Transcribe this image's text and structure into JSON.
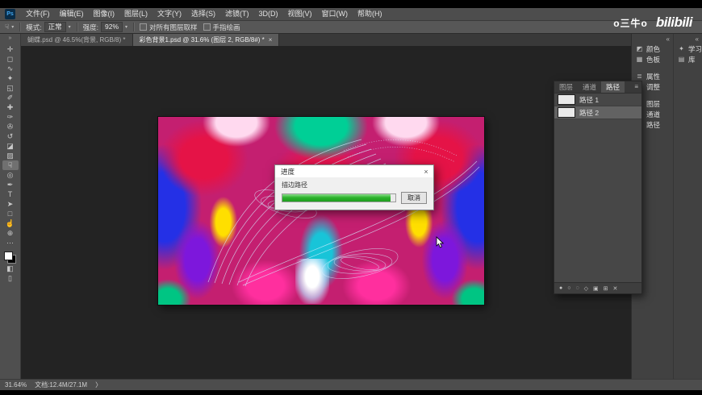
{
  "watermark": {
    "user": "o三牛o",
    "logo": "bilibili"
  },
  "icons": {
    "dropdown_caret": "▾"
  },
  "menubar": {
    "app_icon": "Ps",
    "items": [
      "文件(F)",
      "编辑(E)",
      "图像(I)",
      "图层(L)",
      "文字(Y)",
      "选择(S)",
      "滤镜(T)",
      "3D(D)",
      "视图(V)",
      "窗口(W)",
      "帮助(H)"
    ]
  },
  "options_bar": {
    "tool_icon": "☟",
    "mode_label": "模式:",
    "mode_value": "正常",
    "strength_label": "强度:",
    "strength_value": "92%",
    "sample_all_layers_label": "对所有图层取样",
    "finger_painting_label": "手指绘画"
  },
  "document_tabs": [
    {
      "label": "蝴蝶.psd @ 46.5%(背景, RGB/8) *",
      "active": false
    },
    {
      "label": "彩色背景1.psd @ 31.6% (图层 2, RGB/8#) *",
      "active": true,
      "close": "×"
    }
  ],
  "toolbar": {
    "collapse_icon": "»",
    "tools": [
      {
        "name": "move-tool",
        "glyph": "✛",
        "active": false
      },
      {
        "name": "marquee-tool",
        "glyph": "◻",
        "active": false
      },
      {
        "name": "lasso-tool",
        "glyph": "∿",
        "active": false
      },
      {
        "name": "quick-selection-tool",
        "glyph": "✦",
        "active": false
      },
      {
        "name": "crop-tool",
        "glyph": "◱",
        "active": false
      },
      {
        "name": "eyedropper-tool",
        "glyph": "✐",
        "active": false
      },
      {
        "name": "healing-brush-tool",
        "glyph": "✚",
        "active": false
      },
      {
        "name": "brush-tool",
        "glyph": "✑",
        "active": false
      },
      {
        "name": "clone-stamp-tool",
        "glyph": "✇",
        "active": false
      },
      {
        "name": "history-brush-tool",
        "glyph": "↺",
        "active": false
      },
      {
        "name": "eraser-tool",
        "glyph": "◪",
        "active": false
      },
      {
        "name": "gradient-tool",
        "glyph": "▨",
        "active": false
      },
      {
        "name": "smudge-tool",
        "glyph": "☟",
        "active": true
      },
      {
        "name": "dodge-tool",
        "glyph": "◎",
        "active": false
      },
      {
        "name": "pen-tool",
        "glyph": "✒",
        "active": false
      },
      {
        "name": "type-tool",
        "glyph": "T",
        "active": false
      },
      {
        "name": "path-selection-tool",
        "glyph": "➤",
        "active": false
      },
      {
        "name": "shape-tool",
        "glyph": "□",
        "active": false
      },
      {
        "name": "hand-tool",
        "glyph": "☝",
        "active": false
      },
      {
        "name": "zoom-tool",
        "glyph": "⊕",
        "active": false
      }
    ],
    "more_icon": "⋯",
    "quick_mask_icon": "◧",
    "screen_mode_icon": "▯"
  },
  "right_dock": {
    "collapse_icon": "«",
    "groups": [
      {
        "items": [
          {
            "name": "panel-button-color",
            "icon": "◩",
            "label": "颜色"
          },
          {
            "name": "panel-button-swatches",
            "icon": "▦",
            "label": "色板"
          }
        ]
      },
      {
        "items": [
          {
            "name": "panel-button-properties",
            "icon": "≣",
            "label": "属性"
          },
          {
            "name": "panel-button-adjustments",
            "icon": "◑",
            "label": "调整"
          }
        ]
      },
      {
        "items": [
          {
            "name": "panel-button-layers",
            "icon": "⧉",
            "label": "图层"
          },
          {
            "name": "panel-button-channels",
            "icon": "▣",
            "label": "通道"
          },
          {
            "name": "panel-button-paths",
            "icon": "⌖",
            "label": "路径"
          }
        ]
      }
    ],
    "side_items": [
      {
        "name": "panel-button-learn",
        "icon": "✦",
        "label": "学习"
      },
      {
        "name": "panel-button-libraries",
        "icon": "▤",
        "label": "库"
      }
    ]
  },
  "paths_panel": {
    "tabs": [
      {
        "label": "图层",
        "active": false
      },
      {
        "label": "通道",
        "active": false
      },
      {
        "label": "路径",
        "active": true
      }
    ],
    "menu_icon": "≡",
    "rows": [
      {
        "label": "路径 1",
        "active": false
      },
      {
        "label": "路径 2",
        "active": true
      }
    ],
    "footer_icons": [
      {
        "name": "fill-path-icon",
        "glyph": "●"
      },
      {
        "name": "stroke-path-icon",
        "glyph": "○"
      },
      {
        "name": "load-selection-icon",
        "glyph": "◌"
      },
      {
        "name": "make-work-path-icon",
        "glyph": "◇"
      },
      {
        "name": "add-mask-icon",
        "glyph": "▣"
      },
      {
        "name": "new-path-icon",
        "glyph": "⊞"
      },
      {
        "name": "delete-path-icon",
        "glyph": "✕"
      }
    ]
  },
  "progress_dialog": {
    "title": "进度",
    "close": "×",
    "task_label": "描边路径",
    "progress_percent": 96,
    "cancel_label": "取消"
  },
  "status_bar": {
    "zoom": "31.64%",
    "doc_info": "文档:12.4M/27.1M",
    "chevron": "〉"
  }
}
